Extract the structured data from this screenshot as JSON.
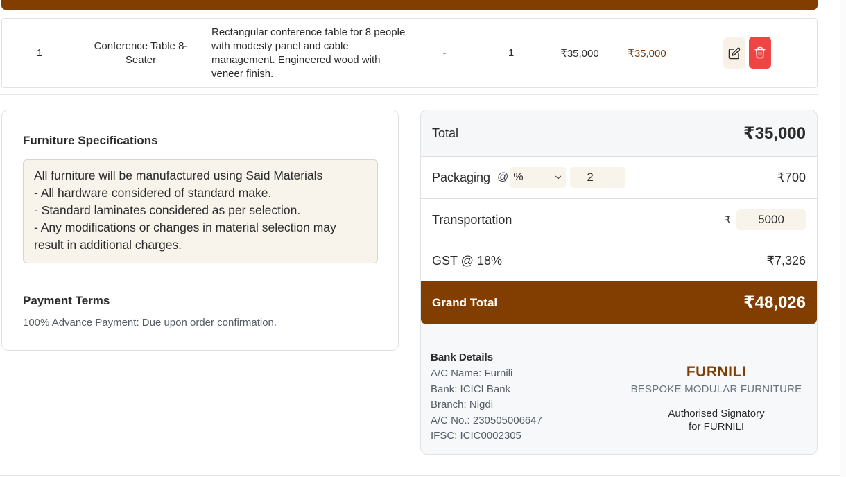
{
  "item_row": {
    "sno": "1",
    "name": "Conference Table 8-Seater",
    "description": "Rectangular conference table for 8 people with modesty panel and cable management. Engineered wood with veneer finish.",
    "dimensions": "-",
    "qty": "1",
    "rate": "₹35,000",
    "amount": "₹35,000",
    "icons": {
      "edit": "edit-icon",
      "delete": "trash-icon"
    }
  },
  "specs": {
    "title": "Furniture Specifications",
    "lines": [
      "All furniture will be manufactured using Said Materials",
      "- All hardware considered of standard make.",
      "- Standard laminates considered as per selection.",
      "- Any modifications or changes in material selection may result in additional charges."
    ],
    "payment_title": "Payment Terms",
    "payment_text": "100% Advance Payment: Due upon order confirmation."
  },
  "totals": {
    "total_label": "Total",
    "total_value": "₹35,000",
    "packaging_label": "Packaging",
    "packaging_at": "@",
    "packaging_type": "%",
    "packaging_input": "2",
    "packaging_value": "₹700",
    "transport_label": "Transportation",
    "transport_currency": "₹",
    "transport_input": "5000",
    "gst_label": "GST @ 18%",
    "gst_value": "₹7,326",
    "grand_label": "Grand Total",
    "grand_value": "₹48,026"
  },
  "bank": {
    "title": "Bank Details",
    "ac_name": "A/C Name: Furnili",
    "bank": "Bank: ICICI Bank",
    "branch": "Branch: Nigdi",
    "ac_no": "A/C No.: 230505006647",
    "ifsc": "IFSC: ICIC0002305"
  },
  "brand": {
    "name": "FURNILI",
    "tagline": "BESPOKE MODULAR FURNITURE",
    "sign_line1": "Authorised Signatory",
    "sign_line2": "for FURNILI"
  },
  "colors": {
    "brand": "#823e00",
    "accent_bg": "#f8f3eb",
    "delete": "#ef4444"
  }
}
